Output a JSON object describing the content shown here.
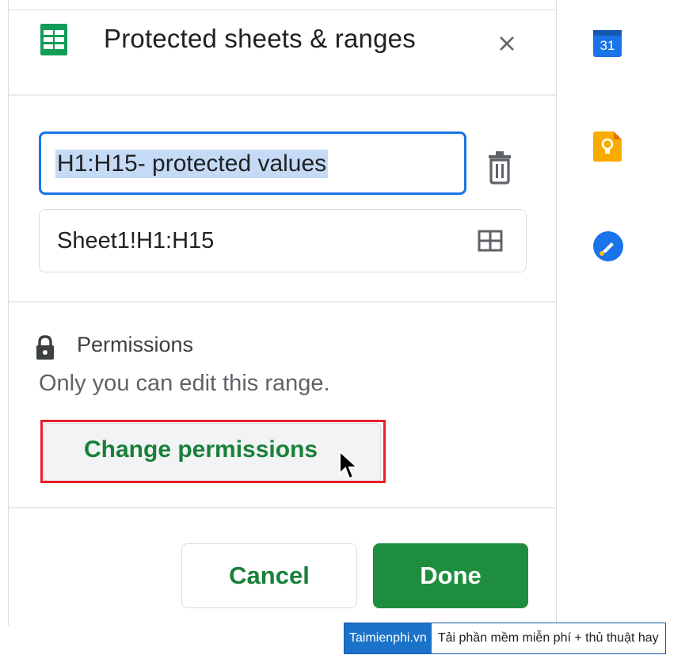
{
  "panel": {
    "title": "Protected sheets & ranges",
    "description_input": {
      "value": "H1:H15- protected values"
    },
    "range_input": {
      "value": "Sheet1!H1:H15"
    },
    "permissions": {
      "heading": "Permissions",
      "description": "Only you can edit this range.",
      "change_button": "Change permissions"
    },
    "cancel_button": "Cancel",
    "done_button": "Done"
  },
  "sidebar": {
    "calendar_day": "31"
  },
  "watermark": {
    "brand": "Taimienphi.vn",
    "tagline": "Tải phần mềm miễn phí + thủ thuật hay"
  },
  "colors": {
    "accent_green": "#188038",
    "done_green": "#1e8e3e",
    "focus_blue": "#1a73e8",
    "highlight_red": "#e8202a"
  }
}
